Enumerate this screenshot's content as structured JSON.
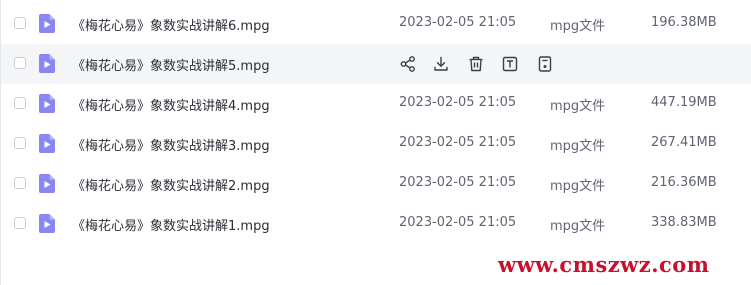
{
  "files": [
    {
      "name": "《梅花心易》象数实战讲解6.mpg",
      "date": "2023-02-05 21:05",
      "type": "mpg文件",
      "size": "196.38MB"
    },
    {
      "name": "《梅花心易》象数实战讲解5.mpg",
      "hovered": true,
      "actions": [
        "share-icon",
        "download-icon",
        "delete-icon",
        "rename-icon",
        "more-icon"
      ]
    },
    {
      "name": "《梅花心易》象数实战讲解4.mpg",
      "date": "2023-02-05 21:05",
      "type": "mpg文件",
      "size": "447.19MB"
    },
    {
      "name": "《梅花心易》象数实战讲解3.mpg",
      "date": "2023-02-05 21:05",
      "type": "mpg文件",
      "size": "267.41MB"
    },
    {
      "name": "《梅花心易》象数实战讲解2.mpg",
      "date": "2023-02-05 21:05",
      "type": "mpg文件",
      "size": "216.36MB"
    },
    {
      "name": "《梅花心易》象数实战讲解1.mpg",
      "date": "2023-02-05 21:05",
      "type": "mpg文件",
      "size": "338.83MB"
    }
  ],
  "colors": {
    "file_icon": "#8b87f2",
    "hover_row": "#f4f5f7",
    "watermark": "#c8102e"
  },
  "watermark": "www.cmszwz.com"
}
